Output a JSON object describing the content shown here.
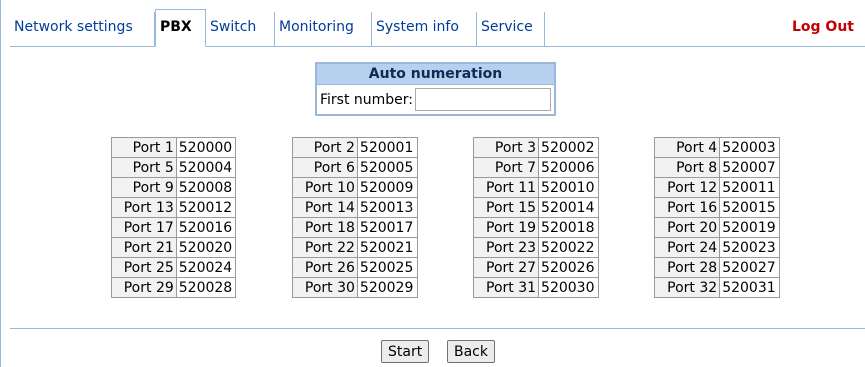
{
  "tabs": [
    {
      "label": "Network settings",
      "active": false
    },
    {
      "label": "PBX",
      "active": true
    },
    {
      "label": "Switch",
      "active": false
    },
    {
      "label": "Monitoring",
      "active": false
    },
    {
      "label": "System info",
      "active": false
    },
    {
      "label": "Service",
      "active": false
    }
  ],
  "logout_label": "Log Out",
  "auto_numeration": {
    "title": "Auto numeration",
    "first_number_label": "First number:",
    "first_number_value": ""
  },
  "ports": [
    {
      "label": "Port 1",
      "number": "520000"
    },
    {
      "label": "Port 2",
      "number": "520001"
    },
    {
      "label": "Port 3",
      "number": "520002"
    },
    {
      "label": "Port 4",
      "number": "520003"
    },
    {
      "label": "Port 5",
      "number": "520004"
    },
    {
      "label": "Port 6",
      "number": "520005"
    },
    {
      "label": "Port 7",
      "number": "520006"
    },
    {
      "label": "Port 8",
      "number": "520007"
    },
    {
      "label": "Port 9",
      "number": "520008"
    },
    {
      "label": "Port 10",
      "number": "520009"
    },
    {
      "label": "Port 11",
      "number": "520010"
    },
    {
      "label": "Port 12",
      "number": "520011"
    },
    {
      "label": "Port 13",
      "number": "520012"
    },
    {
      "label": "Port 14",
      "number": "520013"
    },
    {
      "label": "Port 15",
      "number": "520014"
    },
    {
      "label": "Port 16",
      "number": "520015"
    },
    {
      "label": "Port 17",
      "number": "520016"
    },
    {
      "label": "Port 18",
      "number": "520017"
    },
    {
      "label": "Port 19",
      "number": "520018"
    },
    {
      "label": "Port 20",
      "number": "520019"
    },
    {
      "label": "Port 21",
      "number": "520020"
    },
    {
      "label": "Port 22",
      "number": "520021"
    },
    {
      "label": "Port 23",
      "number": "520022"
    },
    {
      "label": "Port 24",
      "number": "520023"
    },
    {
      "label": "Port 25",
      "number": "520024"
    },
    {
      "label": "Port 26",
      "number": "520025"
    },
    {
      "label": "Port 27",
      "number": "520026"
    },
    {
      "label": "Port 28",
      "number": "520027"
    },
    {
      "label": "Port 29",
      "number": "520028"
    },
    {
      "label": "Port 30",
      "number": "520029"
    },
    {
      "label": "Port 31",
      "number": "520030"
    },
    {
      "label": "Port 32",
      "number": "520031"
    }
  ],
  "buttons": {
    "start": "Start",
    "back": "Back"
  },
  "colors": {
    "tab_text": "#003d99",
    "logout": "#c30000",
    "border": "#9bb8d8",
    "header_bg": "#b7d0ef"
  }
}
